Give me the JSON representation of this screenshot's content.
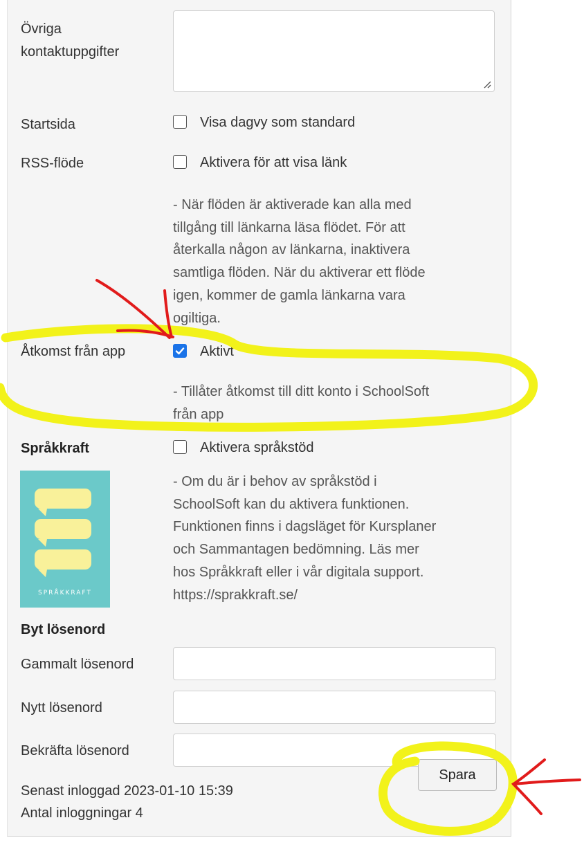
{
  "form": {
    "other_contact_label_line1": "Övriga",
    "other_contact_label_line2": "kontaktuppgifter",
    "startpage_label": "Startsida",
    "startpage_checkbox_label": "Visa dagvy som standard",
    "startpage_checked": false,
    "rss_label": "RSS-flöde",
    "rss_checkbox_label": "Aktivera för att visa länk",
    "rss_checked": false,
    "rss_help": [
      "- När flöden är aktiverade kan alla med",
      "tillgång till länkarna läsa flödet. För att",
      "återkalla någon av länkarna, inaktivera",
      "samtliga flöden. När du aktiverar ett flöde",
      "igen, kommer de gamla länkarna vara",
      "ogiltiga."
    ],
    "app_access_label": "Åtkomst från app",
    "app_access_checkbox_label": "Aktivt",
    "app_access_checked": true,
    "app_access_help": [
      "- Tillåter åtkomst till ditt konto i SchoolSoft",
      "från app"
    ],
    "sprakkraft_label": "Språkkraft",
    "sprakkraft_checkbox_label": "Aktivera språkstöd",
    "sprakkraft_checked": false,
    "sprakkraft_logo_text": "SPRÅKKRAFT",
    "sprakkraft_help": [
      "- Om du är i behov av språkstöd i",
      "SchoolSoft kan du aktivera funktionen.",
      "Funktionen finns i dagsläget för Kursplaner",
      "och Sammantagen bedömning. Läs mer",
      "hos Språkkraft eller i vår digitala support.",
      "https://sprakkraft.se/"
    ]
  },
  "password": {
    "heading": "Byt lösenord",
    "old_label": "Gammalt lösenord",
    "new_label": "Nytt lösenord",
    "confirm_label": "Bekräfta lösenord"
  },
  "footer": {
    "last_login": "Senast inloggad 2023-01-10 15:39",
    "login_count": "Antal inloggningar 4",
    "save_label": "Spara"
  },
  "colors": {
    "panel": "#f5f5f5",
    "checkbox_checked": "#1a73e8",
    "logo_bg": "#6bc9c9",
    "logo_bubble": "#f9f19a",
    "annotation_yellow": "#f2f21a",
    "annotation_red": "#e11b1b"
  }
}
